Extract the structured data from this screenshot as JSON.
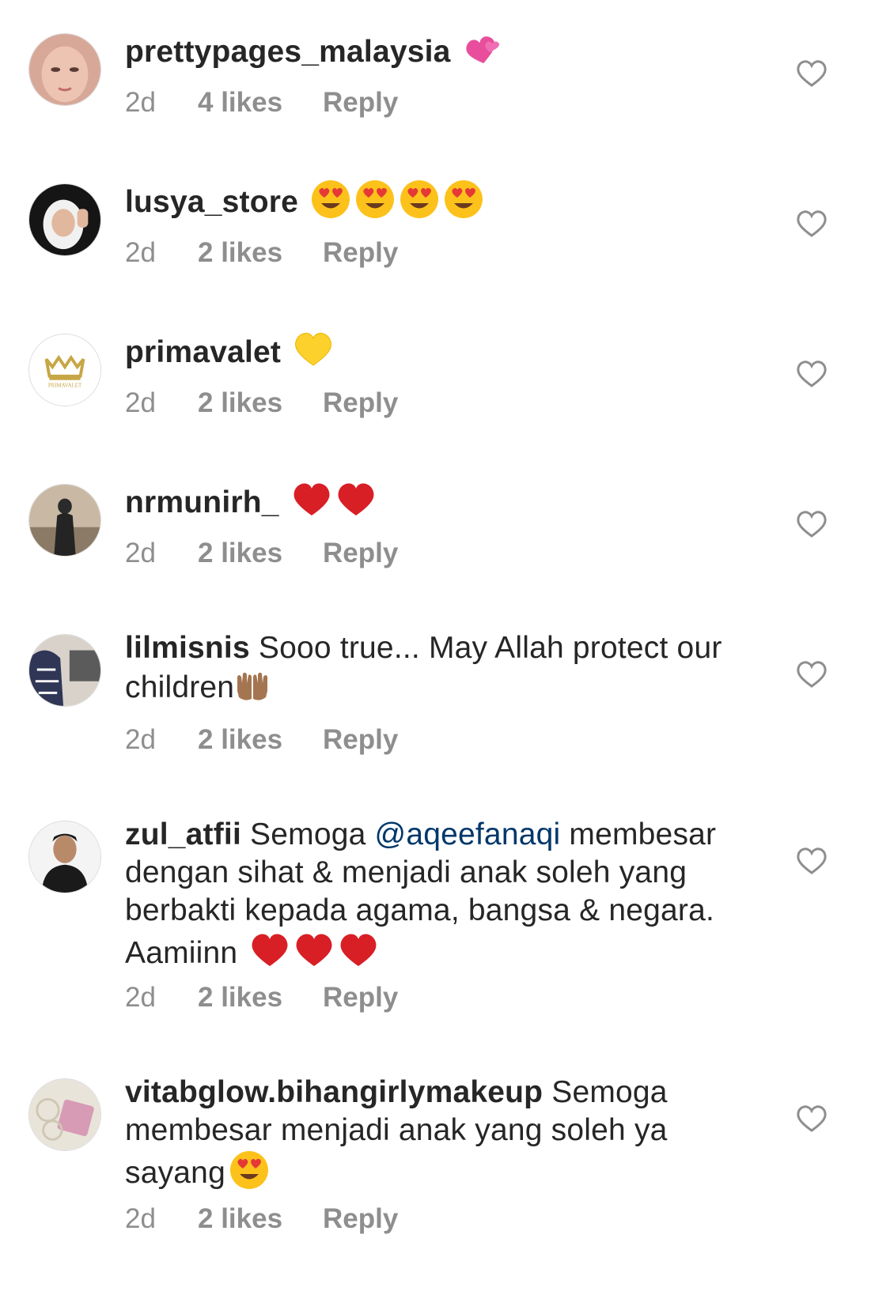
{
  "comments": [
    {
      "username": "prettypages_malaysia",
      "text": "",
      "emojis": [
        "two-hearts"
      ],
      "time": "2d",
      "likes": "4 likes",
      "reply": "Reply",
      "avatar": {
        "colors": [
          "#e9b9a8",
          "#c98f7f"
        ]
      }
    },
    {
      "username": "lusya_store",
      "text": "",
      "emojis": [
        "heart-eyes",
        "heart-eyes",
        "heart-eyes",
        "heart-eyes"
      ],
      "time": "2d",
      "likes": "2 likes",
      "reply": "Reply",
      "avatar": {
        "colors": [
          "#1c1c1c",
          "#f2f2f2"
        ]
      }
    },
    {
      "username": "primavalet",
      "text": "",
      "emojis": [
        "yellow-heart"
      ],
      "time": "2d",
      "likes": "2 likes",
      "reply": "Reply",
      "avatar": {
        "colors": [
          "#ffffff",
          "#c7a646"
        ],
        "logo": "PRIMAVALET"
      }
    },
    {
      "username": "nrmunirh_",
      "text": "",
      "emojis": [
        "red-heart",
        "red-heart"
      ],
      "time": "2d",
      "likes": "2 likes",
      "reply": "Reply",
      "avatar": {
        "colors": [
          "#b9a58e",
          "#3a3a3a"
        ]
      }
    },
    {
      "username": "lilmisnis",
      "text": "Sooo true... May Allah protect our children",
      "emojis": [
        "palms-up"
      ],
      "time": "2d",
      "likes": "2 likes",
      "reply": "Reply",
      "avatar": {
        "colors": [
          "#3c4466",
          "#d9d2cc"
        ]
      }
    },
    {
      "username": "zul_atfii",
      "text_before": "Semoga",
      "mention": "@aqeefanaqi",
      "text": "membesar dengan sihat & menjadi anak soleh yang berbakti kepada agama, bangsa & negara. Aamiinn",
      "emojis": [
        "red-heart",
        "red-heart",
        "red-heart"
      ],
      "time": "2d",
      "likes": "2 likes",
      "reply": "Reply",
      "avatar": {
        "colors": [
          "#f4f4f4",
          "#1a1a1a"
        ]
      }
    },
    {
      "username": "vitabglow.bihangirlymakeup",
      "text": "Semoga membesar menjadi anak yang soleh ya sayang",
      "emojis": [
        "heart-eyes"
      ],
      "time": "2d",
      "likes": "2 likes",
      "reply": "Reply",
      "avatar": {
        "colors": [
          "#e8e2d6",
          "#c98aa6"
        ]
      }
    }
  ],
  "icons": {
    "like": "heart-outline-icon"
  },
  "colors": {
    "text": "#262626",
    "secondary": "#8e8e8e",
    "mention": "#00376b"
  }
}
